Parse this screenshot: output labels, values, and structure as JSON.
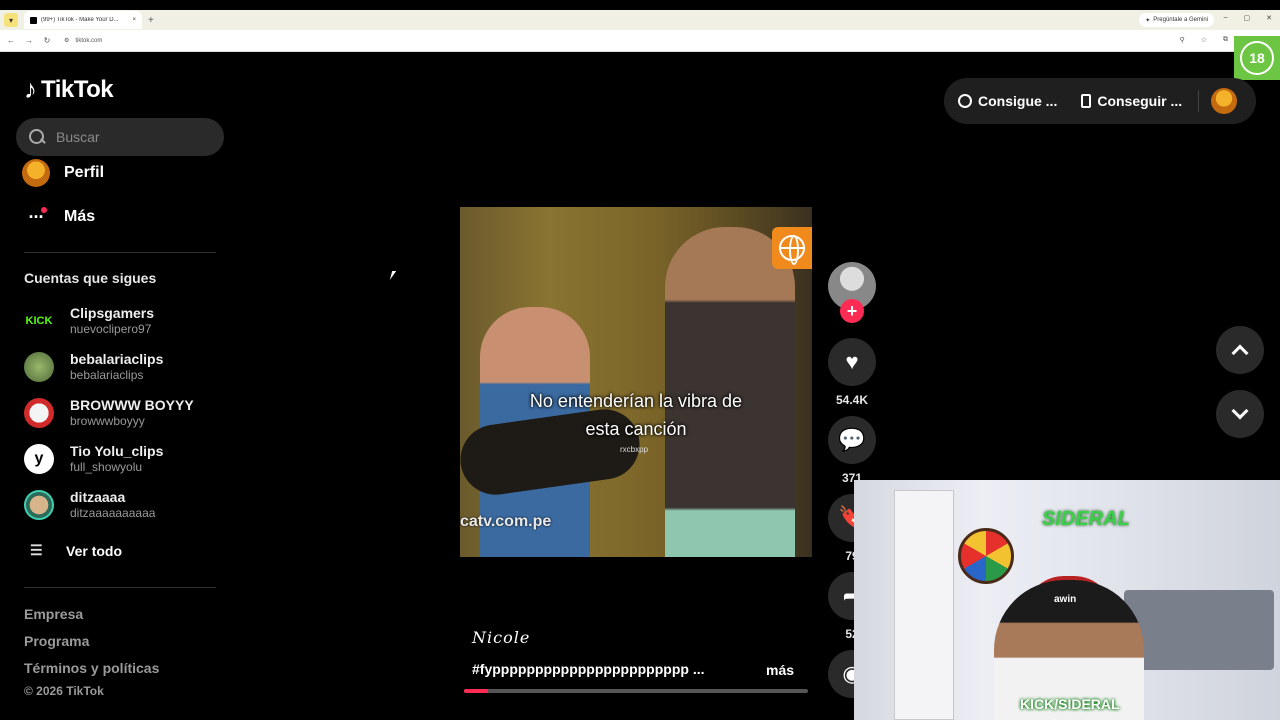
{
  "browser": {
    "tab_title": "(99+) TikTok - Make Your D...",
    "url": "tiktok.com",
    "gemini_label": "Pregúntale a Gemini",
    "age_badge": "18"
  },
  "sidebar": {
    "logo_text": "TikTok",
    "search_placeholder": "Buscar",
    "nav": [
      {
        "label": "Perfil"
      },
      {
        "label": "Más"
      }
    ],
    "following_title": "Cuentas que sigues",
    "accounts": [
      {
        "name": "Clipsgamers",
        "username": "nuevoclipero97",
        "avatar_text": "KICK"
      },
      {
        "name": "bebalariaclips",
        "username": "bebalariaclips",
        "avatar_text": ""
      },
      {
        "name": "BROWWW BOYYY",
        "username": "browwwboyyy",
        "avatar_text": ""
      },
      {
        "name": "Tio Yolu_clips",
        "username": "full_showyolu",
        "avatar_text": "y"
      },
      {
        "name": "ditzaaaa",
        "username": "ditzaaaaaaaaaa",
        "avatar_text": ""
      }
    ],
    "see_all": "Ver todo",
    "footer_links": [
      "Empresa",
      "Programa",
      "Términos y políticas"
    ],
    "copyright": "© 2026 TikTok"
  },
  "topbar": {
    "get_coins": "Consigue ...",
    "get_app": "Conseguir ..."
  },
  "video": {
    "caption_line1": "No entenderían la vibra de",
    "caption_line2": "esta canción",
    "caption_sub": "rxcbxpp",
    "watermark": "catv.com.pe",
    "author": "𝑁𝑖𝑐𝑜𝑙𝑒",
    "description": "#fyppppppppppppppppppppppp ...",
    "more": "más",
    "progress": 0.07
  },
  "actions": {
    "likes": "54.4K",
    "comments": "371",
    "saves": "79",
    "shares": "52"
  },
  "webcam": {
    "sign_text": "SIDERAL",
    "hat_text": "awin",
    "kick_text": "KICK/SIDERAL"
  },
  "colors": {
    "accent": "#fe2c55",
    "badge_green": "#6cc644"
  }
}
